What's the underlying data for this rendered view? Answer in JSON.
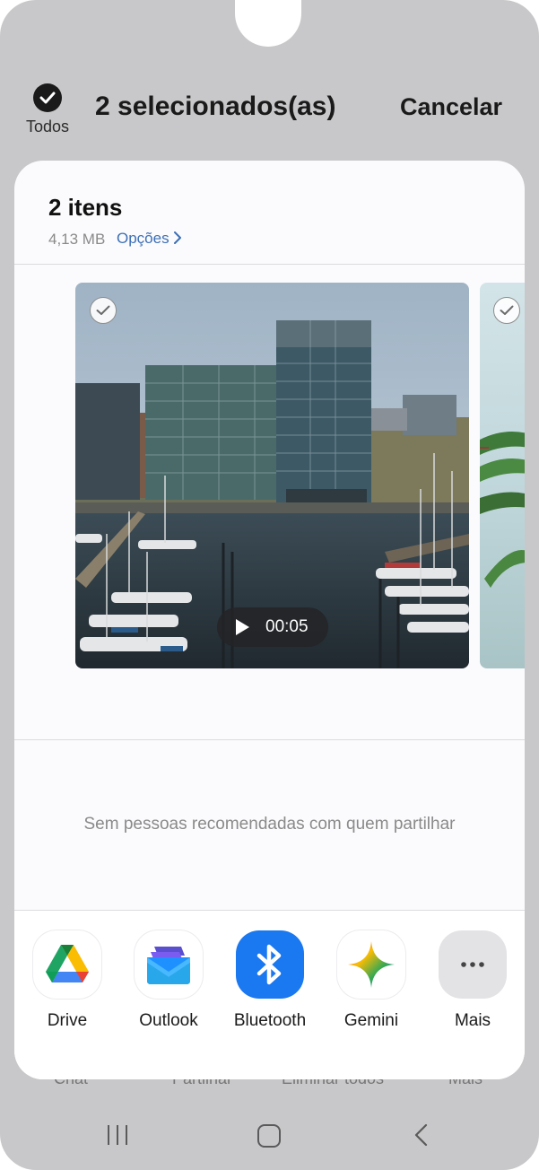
{
  "header": {
    "select_all_label": "Todos",
    "title": "2 selecionados(as)",
    "cancel_label": "Cancelar"
  },
  "sheet": {
    "title": "2 itens",
    "size": "4,13 MB",
    "options_label": "Opções",
    "video_duration": "00:05",
    "no_people_text": "Sem pessoas recomendadas com quem partilhar"
  },
  "apps": [
    {
      "label": "Drive",
      "icon": "drive-icon"
    },
    {
      "label": "Outlook",
      "icon": "outlook-icon"
    },
    {
      "label": "Bluetooth",
      "icon": "bluetooth-icon"
    },
    {
      "label": "Gemini",
      "icon": "gemini-icon"
    },
    {
      "label": "Mais",
      "icon": "more-icon"
    }
  ],
  "bottom_actions": [
    "Chat",
    "Partilhar",
    "Eliminar todos",
    "Mais"
  ],
  "colors": {
    "background": "#c8c8ca",
    "sheet": "#fbfbfd",
    "accent_link": "#3c6fb6",
    "bluetooth": "#1a78f0"
  }
}
